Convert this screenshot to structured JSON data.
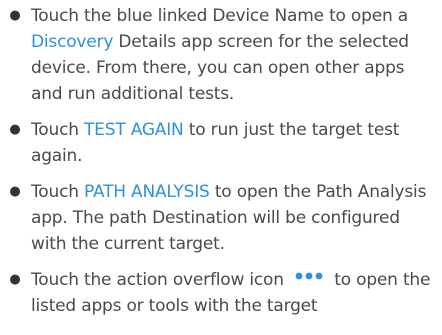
{
  "bullets": [
    {
      "pre": "Touch the blue linked Device Name to open a ",
      "link": "Discovery",
      "post": " Details app screen for the selected device. From there, you can open other apps and run additional tests."
    },
    {
      "pre": "Touch ",
      "link": "TEST AGAIN",
      "post": " to run just the target test again."
    },
    {
      "pre": "Touch ",
      "link": "PATH ANALYSIS",
      "post": " to open the Path Analysis app. The path Destination will be configured with the current target."
    },
    {
      "pre": "Touch the action overflow icon",
      "post": "to open the listed apps or tools with the target"
    }
  ],
  "colors": {
    "text": "#4a4a4a",
    "link": "#2f8fe0",
    "icon": "#2f8fe0"
  },
  "icons": {
    "bullet": "bullet-dot",
    "overflow": "horizontal-ellipsis-icon"
  }
}
